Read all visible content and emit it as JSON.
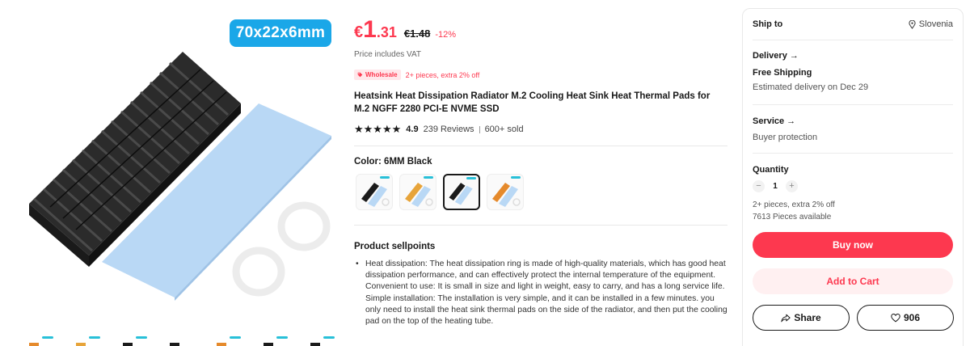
{
  "gallery": {
    "size_badge": "70x22x6mm"
  },
  "price": {
    "currency": "€",
    "integer": "1",
    "decimal": ".31",
    "original": "€1.48",
    "discount": "-12%",
    "vat_note": "Price includes VAT"
  },
  "wholesale": {
    "badge": "Wholesale",
    "offer": "2+ pieces, extra 2% off"
  },
  "product": {
    "title": "Heatsink Heat Dissipation Radiator M.2 Cooling Heat Sink Heat Thermal Pads for M.2 NGFF 2280 PCI-E NVME SSD",
    "rating": "4.9",
    "reviews": "239 Reviews",
    "sold": "600+ sold",
    "stars": "★★★★★"
  },
  "color": {
    "label": "Color: 6MM Black",
    "selected_index": 2,
    "options": [
      {
        "color": "#1b1b1b"
      },
      {
        "color": "#e7a43a"
      },
      {
        "color": "#1b1b1b"
      },
      {
        "color": "#e58a2c"
      }
    ]
  },
  "sellpoints": {
    "title": "Product sellpoints",
    "bullet": "•",
    "line1": "Heat dissipation: The heat dissipation ring is made of high-quality materials, which has good heat dissipation performance, and can effectively protect the internal temperature of the equipment.",
    "line2": "Convenient to use: It is small in size and light in weight, easy to carry, and has a long service life.",
    "line3": "Simple installation: The installation is very simple, and it can be installed in a few minutes. you only need to install the heat sink thermal pads on the side of the radiator, and then put the cooling pad on the top of the heating tube."
  },
  "panel": {
    "ship_to_label": "Ship to",
    "ship_to_country": "Slovenia",
    "delivery_label": "Delivery",
    "shipping": "Free Shipping",
    "estimated": "Estimated delivery on Dec 29",
    "service_label": "Service",
    "service_value": "Buyer protection",
    "quantity_label": "Quantity",
    "quantity_value": "1",
    "qty_minus": "−",
    "qty_plus": "+",
    "bulk_offer": "2+ pieces, extra 2% off",
    "available": "7613 Pieces available",
    "buy_now": "Buy now",
    "add_to_cart": "Add to Cart",
    "share": "Share",
    "wishlist_count": "906",
    "arrow": "→"
  },
  "colors": {
    "accent": "#fd384f",
    "badge_blue": "#1aa7e8",
    "pad_blue": "#b9d8f5"
  }
}
